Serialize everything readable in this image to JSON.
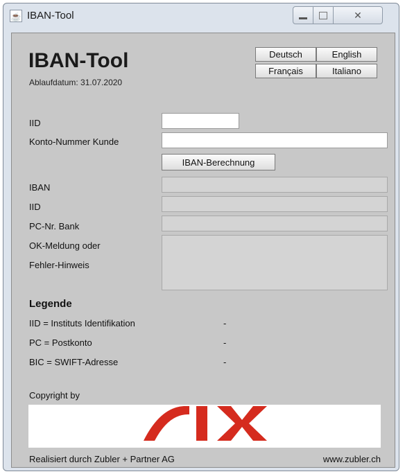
{
  "window": {
    "title": "IBAN-Tool",
    "close_glyph": "✕"
  },
  "header": {
    "app_title": "IBAN-Tool",
    "expiry": "Ablaufdatum: 31.07.2020"
  },
  "languages": {
    "de": "Deutsch",
    "en": "English",
    "fr": "Français",
    "it": "Italiano"
  },
  "form": {
    "iid_label": "IID",
    "iid_value": "",
    "account_label": "Konto-Nummer Kunde",
    "account_value": "",
    "calculate_label": "IBAN-Berechnung"
  },
  "results": {
    "iban_label": "IBAN",
    "iid_label": "IID",
    "pc_label": "PC-Nr. Bank",
    "message_label_1": "OK-Meldung oder",
    "message_label_2": "Fehler-Hinweis"
  },
  "legend": {
    "title": "Legende",
    "items": [
      {
        "term": "IID  = Instituts Identifikation",
        "value": "-"
      },
      {
        "term": "PC  = Postkonto",
        "value": "-"
      },
      {
        "term": "BIC = SWIFT-Adresse",
        "value": "-"
      }
    ]
  },
  "footer": {
    "copyright": "Copyright by",
    "logo_text": "SIX",
    "realized_by": "Realisiert durch Zubler + Partner AG",
    "website": "www.zubler.ch"
  },
  "colors": {
    "logo_red": "#d52b1e",
    "panel_bg": "#c8c8c8"
  }
}
